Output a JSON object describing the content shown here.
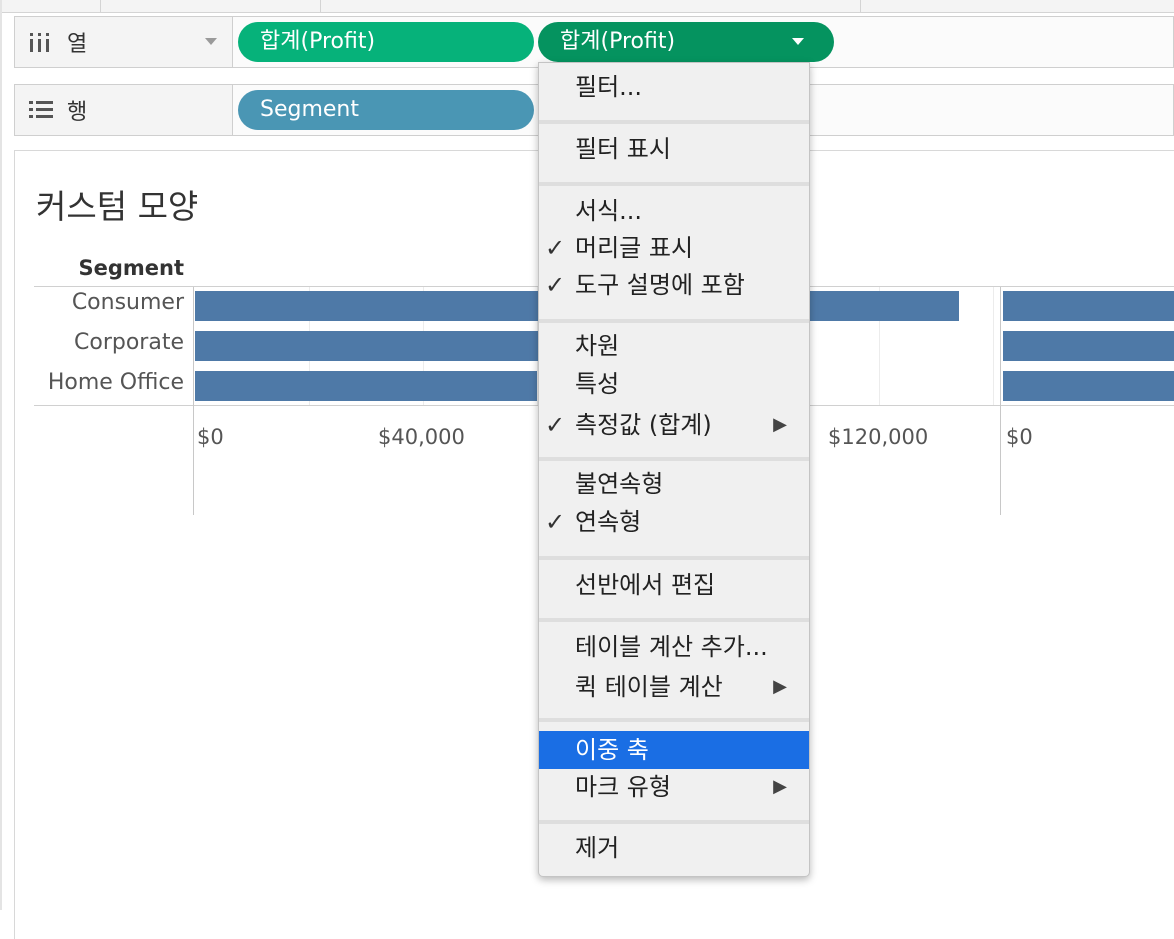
{
  "shelves": {
    "columns": {
      "label": "열",
      "pills": [
        "합계(Profit)",
        "합계(Profit)"
      ]
    },
    "rows": {
      "label": "행",
      "pills": [
        "Segment"
      ]
    }
  },
  "sheet": {
    "title": "커스텀 모양"
  },
  "chart_data": {
    "type": "bar",
    "row_header": "Segment",
    "categories": [
      "Consumer",
      "Corporate",
      "Home Office"
    ],
    "series": [
      {
        "values": [
          134000,
          92000,
          60000
        ]
      }
    ],
    "x_ticks": [
      "$0",
      "$40,000",
      "$120,000"
    ],
    "second_axis_ticks": [
      "$0"
    ],
    "xlim": [
      0,
      160000
    ],
    "orientation": "horizontal",
    "colors": {
      "bar": "#4e79a7"
    }
  },
  "context_menu": {
    "items": [
      {
        "label": "필터...",
        "checked": false,
        "submenu": false
      },
      {
        "label": "필터 표시",
        "checked": false,
        "submenu": false
      },
      {
        "label": "서식...",
        "checked": false,
        "submenu": false
      },
      {
        "label": "머리글 표시",
        "checked": true,
        "submenu": false
      },
      {
        "label": "도구 설명에 포함",
        "checked": true,
        "submenu": false
      },
      {
        "label": "차원",
        "checked": false,
        "submenu": false
      },
      {
        "label": "특성",
        "checked": false,
        "submenu": false
      },
      {
        "label": "측정값 (합계)",
        "checked": true,
        "submenu": true
      },
      {
        "label": "불연속형",
        "checked": false,
        "submenu": false
      },
      {
        "label": "연속형",
        "checked": true,
        "submenu": false
      },
      {
        "label": "선반에서 편집",
        "checked": false,
        "submenu": false
      },
      {
        "label": "테이블 계산 추가...",
        "checked": false,
        "submenu": false
      },
      {
        "label": "퀵 테이블 계산",
        "checked": false,
        "submenu": true
      },
      {
        "label": "이중 축",
        "checked": false,
        "submenu": false,
        "highlighted": true
      },
      {
        "label": "마크 유형",
        "checked": false,
        "submenu": true
      },
      {
        "label": "제거",
        "checked": false,
        "submenu": false
      }
    ],
    "glyphs": {
      "check": "✓",
      "submenu_arrow": "▶"
    }
  },
  "colors": {
    "pill_green": "#06b27a",
    "pill_green_active": "#05935f",
    "pill_blue": "#4a96b4",
    "menu_highlight": "#1a6ee4"
  }
}
